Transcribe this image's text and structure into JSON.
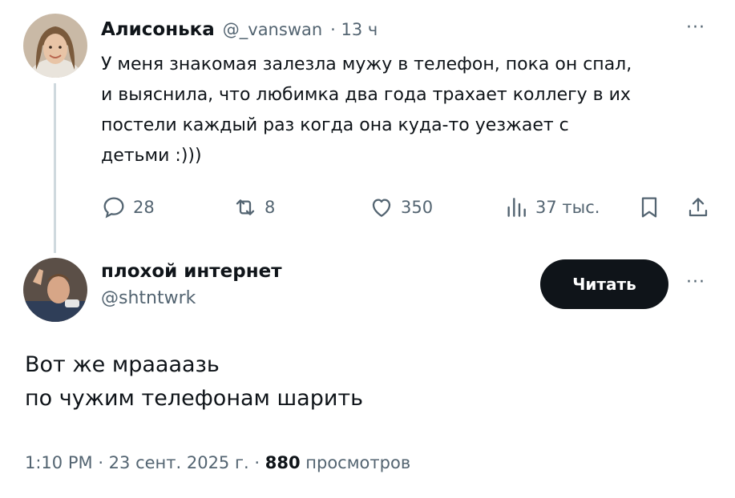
{
  "quoted_tweet": {
    "author_name": "Алисонька",
    "handle": "@_vanswan",
    "time": "· 13 ч",
    "more": "···",
    "text_lines": [
      "У меня знакомая залезла мужу в телефон, пока он спал,",
      "и выяснила, что любимка два года трахает коллегу в их",
      "постели каждый раз когда она куда-то уезжает с",
      "детьми :)))"
    ],
    "actions": {
      "replies": "28",
      "retweets": "8",
      "likes": "350",
      "views": "37 тыс."
    },
    "icons": [
      "reply-icon",
      "retweet-icon",
      "like-icon",
      "views-icon",
      "bookmark-icon",
      "share-icon"
    ]
  },
  "main_tweet": {
    "author_name": "плохой интернет",
    "handle": "@shtntwrk",
    "follow_label": "Читать",
    "more": "···",
    "text_lines": [
      "Вот же мраааазь",
      "по чужим телефонам шарить"
    ],
    "time": "1:10 PM",
    "date": "23 сент. 2025 г.",
    "views_count": "880",
    "views_label": "просмотров"
  },
  "colors": {
    "text": "#0f1419",
    "muted": "#536471",
    "thread_line": "#cfd9de",
    "button_bg": "#0f1419"
  }
}
